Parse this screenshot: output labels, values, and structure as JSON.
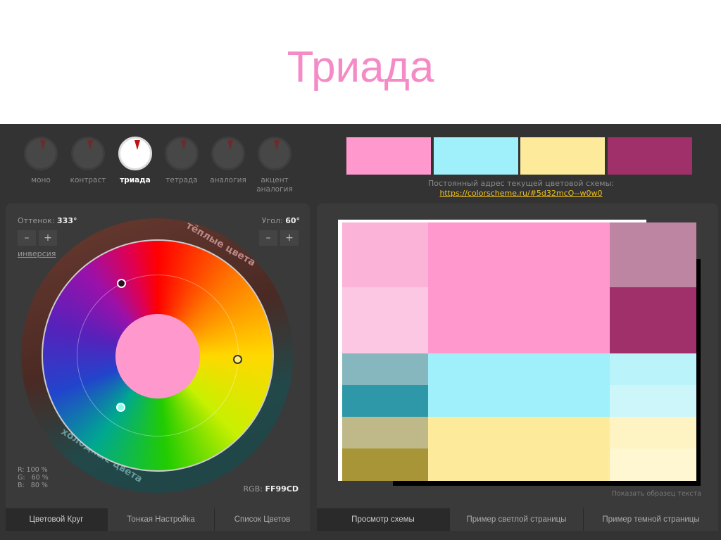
{
  "slide_title": "Триада",
  "schemes": [
    {
      "label": "моно"
    },
    {
      "label": "контраст"
    },
    {
      "label": "триада",
      "active": true
    },
    {
      "label": "тетрада"
    },
    {
      "label": "аналогия"
    },
    {
      "label": "акцент аналогия"
    }
  ],
  "swatches": [
    "#ff99cd",
    "#9ff0fa",
    "#fdeb9b",
    "#a0306a"
  ],
  "permalink": {
    "label": "Постоянный адрес текущей цветовой схемы:",
    "url": "https://colorscheme.ru/#5d32mcO--w0w0"
  },
  "wheel": {
    "hue_label": "Оттенок:",
    "hue_value": "333°",
    "angle_label": "Угол:",
    "angle_value": "60°",
    "minus": "–",
    "plus": "+",
    "inversion": "инверсия",
    "warm": "тёплые цвета",
    "cold": "холодные цвета",
    "rgb_label": "RGB:",
    "rgb_value": "FF99CD",
    "r": "R: 100 %",
    "g": "G:   60 %",
    "b": "B:   80 %",
    "center_color": "#ff99cd"
  },
  "left_tabs": [
    "Цветовой Круг",
    "Тонкая Настройка",
    "Список Цветов"
  ],
  "right_tabs": [
    "Просмотр схемы",
    "Пример светлой страницы",
    "Пример темной страницы"
  ],
  "show_sample": "Показать образец текста",
  "preview_colors": {
    "a1": "#fbb3d8",
    "a2": "#fcc7e2",
    "a3": "#87b7be",
    "a4": "#2f98a8",
    "a5": "#bfb98a",
    "a6": "#a89538",
    "main": "#ff99cd",
    "cyan": "#9ff0fa",
    "yellow": "#fdeb9b",
    "c1": "#be85a3",
    "c2": "#a0306a",
    "c3": "#bbf3fb",
    "c4": "#cdf6fb",
    "c5": "#fef3c2",
    "c6": "#fff6d2"
  }
}
